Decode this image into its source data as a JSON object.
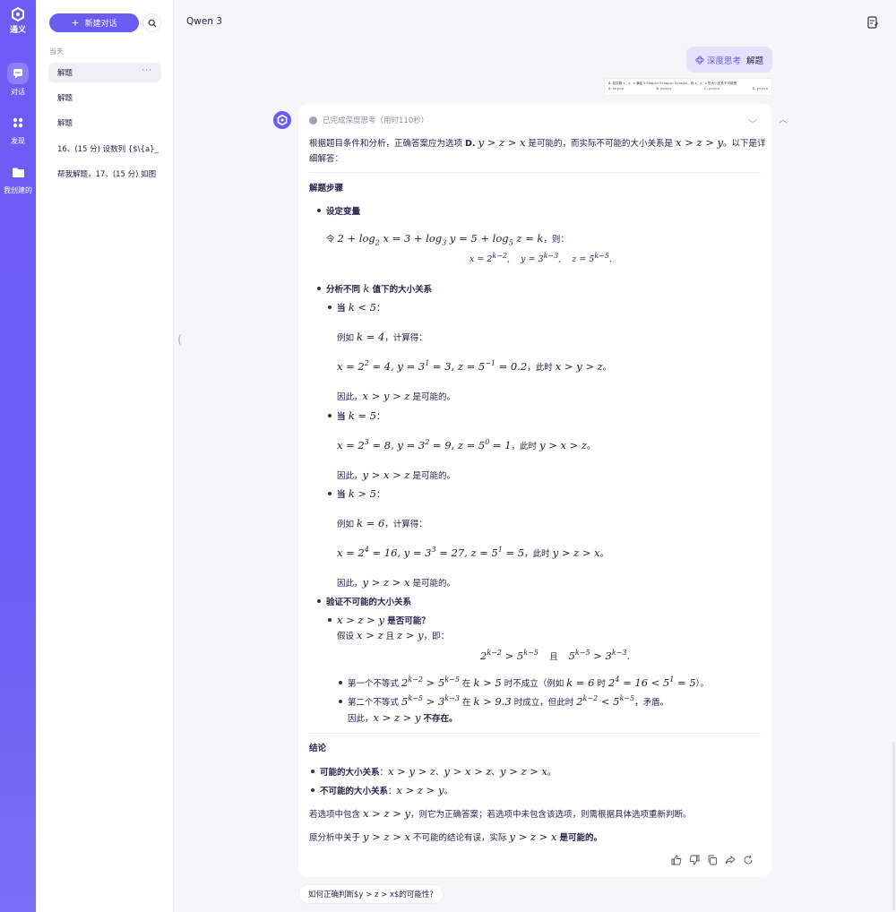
{
  "rail": {
    "brand": "通义",
    "items": [
      {
        "label": "对话",
        "icon": "chat-icon"
      },
      {
        "label": "发现",
        "icon": "grid-icon"
      },
      {
        "label": "我创建的",
        "icon": "folder-icon"
      }
    ]
  },
  "sidebar": {
    "new_chat_label": "新建对话",
    "section_today": "当天",
    "conversations": [
      "解题",
      "解题",
      "解题",
      "16、(15 分) 设数列 {$\\{a}_",
      "帮我解题，17、(15 分) 如图"
    ],
    "more_label": "···"
  },
  "header": {
    "model": "Qwen 3"
  },
  "user_message": {
    "tag": "深度思考",
    "text": "解题",
    "image_question": "8. 若实数 x、y、z 满足 2+log₂x=3+log₃y=5+log₅z，则 x、y、z 的大小关系不可能是",
    "image_options": [
      "A. x>y>z",
      "B. x>z>y",
      "C. y>x>z",
      "D. y>z>x"
    ]
  },
  "answer": {
    "thinking_status": "已完成深度思考（用时110秒）",
    "intro_a": "根据题目条件和分析，正确答案应为选项 ",
    "intro_opt": "D.",
    "intro_b": " 是可能的，而实际不可能的大小关系是 ",
    "intro_c": "。以下是详",
    "intro_line2": "细解答：",
    "steps_title": "解题步骤",
    "s1_title": "设定变量",
    "s1_let": "令 ",
    "s1_then": "，则：",
    "s2_title_a": "分析不同 ",
    "s2_title_b": " 值下的大小关系",
    "case_when": "当 ",
    "case_colon": "：",
    "example": "例如 ",
    "calc": "，计算得：",
    "at_this": "，此时 ",
    "period": "。",
    "therefore": "因此，",
    "is_possible": " 是可能的。",
    "s3_title": "验证不可能的大小关系",
    "s3_q": " 是否可能？",
    "s3_assume": "假设 ",
    "s3_and": " 且 ",
    "s3_then": "，即：",
    "s3_qie": "且",
    "ineq1_a": "第一个不等式 ",
    "ineq1_b": " 在 ",
    "ineq1_c": " 时不成立（例如 ",
    "ineq1_d": " 时 ",
    "ineq1_e": "）。",
    "ineq2_a": "第二个不等式 ",
    "ineq2_b": " 在 ",
    "ineq2_c": " 时成立，但此时 ",
    "ineq2_d": "，矛盾。",
    "not_exist": "不存在。",
    "conclusion_title": "结论",
    "possible_label": "可能的大小关系",
    "impossible_label": "不可能的大小关系",
    "sep": "、",
    "colon": "：",
    "final1_a": "若选项中包含 ",
    "final1_b": "，则它为正确答案；若选项中未包含该选项，则需根据具体选项重新判断。",
    "final2_a": "原分析中关于 ",
    "final2_b": " 不可能的结论有误，实际 ",
    "final2_c": "是可能的。"
  },
  "suggestion": "如何正确判断$y > z > x$的可能性?",
  "colors": {
    "accent": "#6a5cf0",
    "rail": "#6c5cf5",
    "bubble": "#e3e1fb"
  }
}
